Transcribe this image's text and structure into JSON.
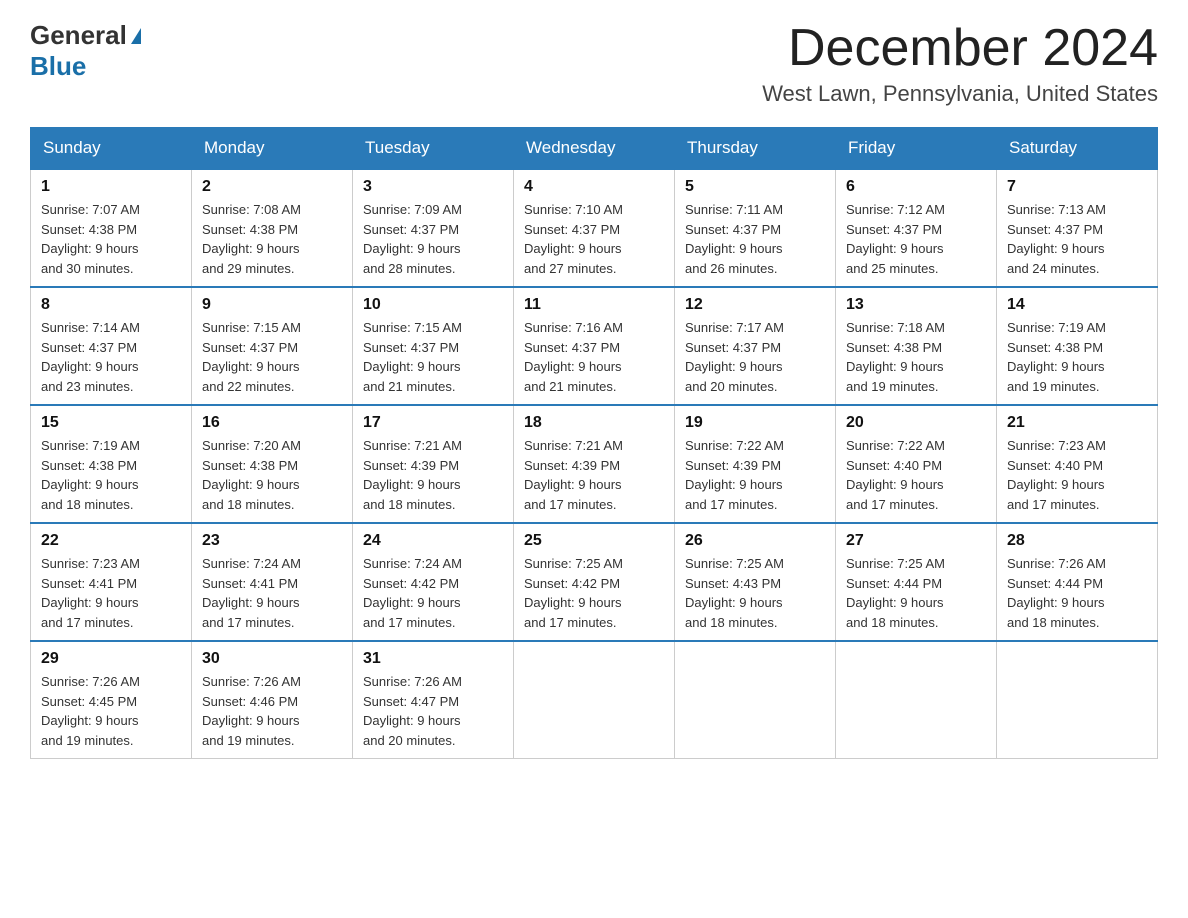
{
  "header": {
    "logo_text_general": "General",
    "logo_text_blue": "Blue",
    "month": "December 2024",
    "location": "West Lawn, Pennsylvania, United States"
  },
  "days_of_week": [
    "Sunday",
    "Monday",
    "Tuesday",
    "Wednesday",
    "Thursday",
    "Friday",
    "Saturday"
  ],
  "weeks": [
    [
      {
        "day": "1",
        "sunrise": "7:07 AM",
        "sunset": "4:38 PM",
        "daylight": "9 hours and 30 minutes."
      },
      {
        "day": "2",
        "sunrise": "7:08 AM",
        "sunset": "4:38 PM",
        "daylight": "9 hours and 29 minutes."
      },
      {
        "day": "3",
        "sunrise": "7:09 AM",
        "sunset": "4:37 PM",
        "daylight": "9 hours and 28 minutes."
      },
      {
        "day": "4",
        "sunrise": "7:10 AM",
        "sunset": "4:37 PM",
        "daylight": "9 hours and 27 minutes."
      },
      {
        "day": "5",
        "sunrise": "7:11 AM",
        "sunset": "4:37 PM",
        "daylight": "9 hours and 26 minutes."
      },
      {
        "day": "6",
        "sunrise": "7:12 AM",
        "sunset": "4:37 PM",
        "daylight": "9 hours and 25 minutes."
      },
      {
        "day": "7",
        "sunrise": "7:13 AM",
        "sunset": "4:37 PM",
        "daylight": "9 hours and 24 minutes."
      }
    ],
    [
      {
        "day": "8",
        "sunrise": "7:14 AM",
        "sunset": "4:37 PM",
        "daylight": "9 hours and 23 minutes."
      },
      {
        "day": "9",
        "sunrise": "7:15 AM",
        "sunset": "4:37 PM",
        "daylight": "9 hours and 22 minutes."
      },
      {
        "day": "10",
        "sunrise": "7:15 AM",
        "sunset": "4:37 PM",
        "daylight": "9 hours and 21 minutes."
      },
      {
        "day": "11",
        "sunrise": "7:16 AM",
        "sunset": "4:37 PM",
        "daylight": "9 hours and 21 minutes."
      },
      {
        "day": "12",
        "sunrise": "7:17 AM",
        "sunset": "4:37 PM",
        "daylight": "9 hours and 20 minutes."
      },
      {
        "day": "13",
        "sunrise": "7:18 AM",
        "sunset": "4:38 PM",
        "daylight": "9 hours and 19 minutes."
      },
      {
        "day": "14",
        "sunrise": "7:19 AM",
        "sunset": "4:38 PM",
        "daylight": "9 hours and 19 minutes."
      }
    ],
    [
      {
        "day": "15",
        "sunrise": "7:19 AM",
        "sunset": "4:38 PM",
        "daylight": "9 hours and 18 minutes."
      },
      {
        "day": "16",
        "sunrise": "7:20 AM",
        "sunset": "4:38 PM",
        "daylight": "9 hours and 18 minutes."
      },
      {
        "day": "17",
        "sunrise": "7:21 AM",
        "sunset": "4:39 PM",
        "daylight": "9 hours and 18 minutes."
      },
      {
        "day": "18",
        "sunrise": "7:21 AM",
        "sunset": "4:39 PM",
        "daylight": "9 hours and 17 minutes."
      },
      {
        "day": "19",
        "sunrise": "7:22 AM",
        "sunset": "4:39 PM",
        "daylight": "9 hours and 17 minutes."
      },
      {
        "day": "20",
        "sunrise": "7:22 AM",
        "sunset": "4:40 PM",
        "daylight": "9 hours and 17 minutes."
      },
      {
        "day": "21",
        "sunrise": "7:23 AM",
        "sunset": "4:40 PM",
        "daylight": "9 hours and 17 minutes."
      }
    ],
    [
      {
        "day": "22",
        "sunrise": "7:23 AM",
        "sunset": "4:41 PM",
        "daylight": "9 hours and 17 minutes."
      },
      {
        "day": "23",
        "sunrise": "7:24 AM",
        "sunset": "4:41 PM",
        "daylight": "9 hours and 17 minutes."
      },
      {
        "day": "24",
        "sunrise": "7:24 AM",
        "sunset": "4:42 PM",
        "daylight": "9 hours and 17 minutes."
      },
      {
        "day": "25",
        "sunrise": "7:25 AM",
        "sunset": "4:42 PM",
        "daylight": "9 hours and 17 minutes."
      },
      {
        "day": "26",
        "sunrise": "7:25 AM",
        "sunset": "4:43 PM",
        "daylight": "9 hours and 18 minutes."
      },
      {
        "day": "27",
        "sunrise": "7:25 AM",
        "sunset": "4:44 PM",
        "daylight": "9 hours and 18 minutes."
      },
      {
        "day": "28",
        "sunrise": "7:26 AM",
        "sunset": "4:44 PM",
        "daylight": "9 hours and 18 minutes."
      }
    ],
    [
      {
        "day": "29",
        "sunrise": "7:26 AM",
        "sunset": "4:45 PM",
        "daylight": "9 hours and 19 minutes."
      },
      {
        "day": "30",
        "sunrise": "7:26 AM",
        "sunset": "4:46 PM",
        "daylight": "9 hours and 19 minutes."
      },
      {
        "day": "31",
        "sunrise": "7:26 AM",
        "sunset": "4:47 PM",
        "daylight": "9 hours and 20 minutes."
      },
      null,
      null,
      null,
      null
    ]
  ]
}
